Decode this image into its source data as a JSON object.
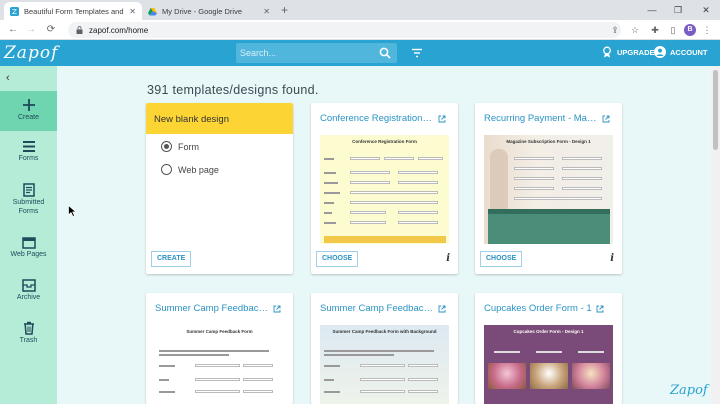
{
  "browser": {
    "tabs": [
      {
        "title": "Beautiful Form Templates and De",
        "active": true
      },
      {
        "title": "My Drive - Google Drive",
        "active": false
      }
    ],
    "url": "zapof.com/home",
    "profile_initial": "B"
  },
  "header": {
    "logo": "Zapof",
    "search_placeholder": "Search...",
    "upgrade_label": "UPGRADE",
    "account_label": "ACCOUNT",
    "accent_color": "#29a3d1"
  },
  "sidebar": {
    "items": [
      {
        "label": "Create",
        "icon": "plus-icon"
      },
      {
        "label": "Forms",
        "icon": "list-icon"
      },
      {
        "label": "Submitted\nForms",
        "icon": "document-icon"
      },
      {
        "label": "Web Pages",
        "icon": "webpage-icon"
      },
      {
        "label": "Archive",
        "icon": "archive-icon"
      },
      {
        "label": "Trash",
        "icon": "trash-icon"
      }
    ]
  },
  "main": {
    "count_text": "391 templates/designs found.",
    "blank_card": {
      "title": "New blank design",
      "options": [
        "Form",
        "Web page"
      ],
      "selected": "Form",
      "button": "CREATE"
    },
    "templates": [
      {
        "title": "Conference Registration Fo...",
        "button": "CHOOSE",
        "preview_title": "Conference Registration Form"
      },
      {
        "title": "Recurring Payment - Magaz...",
        "button": "CHOOSE",
        "preview_title": "Magazine Subscription Form - Design 1"
      },
      {
        "title": "Summer Camp Feedback F...",
        "preview_title": "Summer Camp Feedback Form"
      },
      {
        "title": "Summer Camp Feedback Fo...",
        "preview_title": "Summer Camp Feedback Form with Background"
      },
      {
        "title": "Cupcakes Order Form - 1",
        "preview_title": "Cupcakes Order Form - Design 1"
      }
    ]
  },
  "footer_logo": "Zapof"
}
